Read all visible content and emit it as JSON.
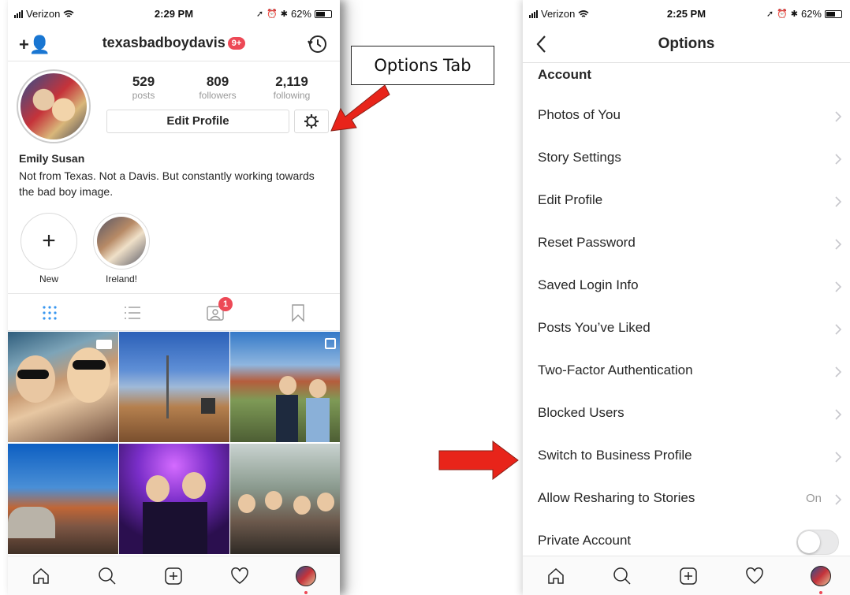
{
  "left_phone": {
    "status": {
      "carrier": "Verizon",
      "time": "2:29 PM",
      "battery": "62%",
      "battery_level": 0.62
    },
    "header": {
      "username": "texasbadboydavis",
      "notification_badge": "9+"
    },
    "stats": [
      {
        "num": "529",
        "label": "posts"
      },
      {
        "num": "809",
        "label": "followers"
      },
      {
        "num": "2,119",
        "label": "following"
      }
    ],
    "edit_profile_label": "Edit Profile",
    "bio": {
      "name": "Emily Susan",
      "text": "Not from Texas. Not a Davis. But constantly working towards the bad boy image."
    },
    "highlights": [
      {
        "caption": "New"
      },
      {
        "caption": "Ireland!"
      }
    ],
    "tagged_badge": "1"
  },
  "callout": {
    "text": "Options Tab"
  },
  "right_phone": {
    "status": {
      "carrier": "Verizon",
      "time": "2:25 PM",
      "battery": "62%",
      "battery_level": 0.62
    },
    "header": {
      "title": "Options"
    },
    "section": "Account",
    "rows": [
      {
        "label": "Photos of You"
      },
      {
        "label": "Story Settings"
      },
      {
        "label": "Edit Profile"
      },
      {
        "label": "Reset Password"
      },
      {
        "label": "Saved Login Info"
      },
      {
        "label": "Posts You’ve Liked"
      },
      {
        "label": "Two-Factor Authentication"
      },
      {
        "label": "Blocked Users"
      },
      {
        "label": "Switch to Business Profile"
      },
      {
        "label": "Allow Resharing to Stories",
        "value": "On"
      },
      {
        "label": "Private Account",
        "toggle": false
      }
    ]
  },
  "colors": {
    "accent_blue": "#3897f0",
    "badge_red": "#ed4956",
    "arrow_red": "#e8241a"
  }
}
